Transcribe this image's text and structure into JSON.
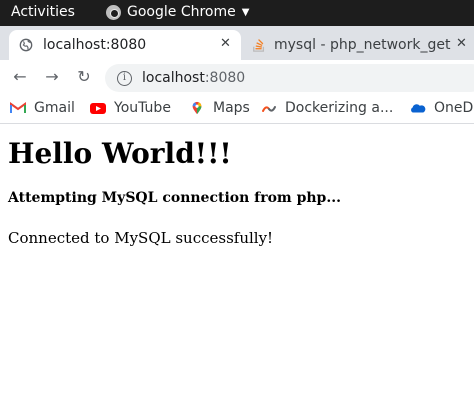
{
  "system_bar": {
    "activities": "Activities",
    "app_name": "Google Chrome"
  },
  "tabs": [
    {
      "title": "localhost:8080",
      "icon": "globe-icon",
      "active": true
    },
    {
      "title": "mysql - php_network_get",
      "icon": "stackoverflow-icon",
      "active": false
    }
  ],
  "address_bar": {
    "host": "localhost",
    "port": ":8080"
  },
  "bookmarks": [
    {
      "label": "Gmail",
      "icon": "gmail-icon"
    },
    {
      "label": "YouTube",
      "icon": "youtube-icon"
    },
    {
      "label": "Maps",
      "icon": "maps-icon"
    },
    {
      "label": "Dockerizing a...",
      "icon": "docker-icon"
    },
    {
      "label": "OneD",
      "icon": "onedrive-icon"
    }
  ],
  "page": {
    "heading": "Hello World!!!",
    "subheading": "Attempting MySQL connection from php...",
    "message": "Connected to MySQL successfully!"
  },
  "colors": {
    "top_bar": "#1d1d1d",
    "tab_strip": "#dee1e6",
    "omnibox": "#f1f3f4",
    "youtube_red": "#ff0000",
    "onedrive_blue": "#0a62d0"
  }
}
